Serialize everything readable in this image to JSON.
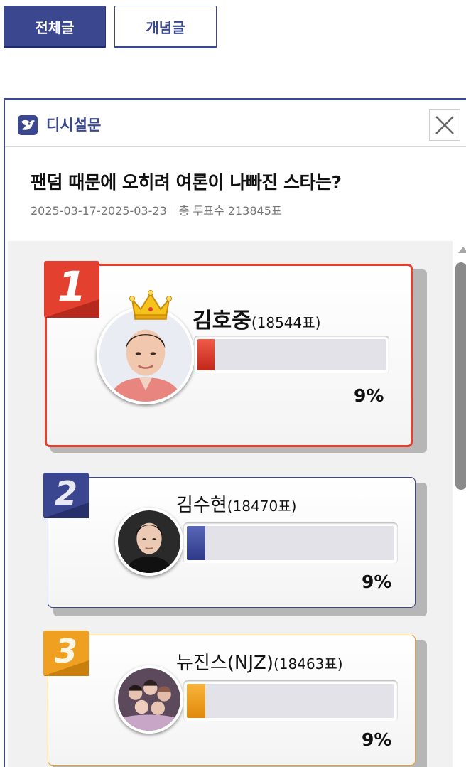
{
  "tabs": {
    "all": "전체글",
    "concept": "개념글"
  },
  "poll": {
    "brand": "디시설문",
    "question": "팬덤 때문에 오히려 여론이 나빠진 스타는?",
    "period": "2025-03-17-2025-03-23",
    "total_label": "총 투표수 213845표",
    "close_label": "close",
    "colors": {
      "accent": "#3b4890",
      "rank1": "#e4402f",
      "rank2": "#3a4690",
      "rank3": "#f0a020"
    },
    "candidates": [
      {
        "rank": "1",
        "name": "김호중",
        "votes": "(18544표)",
        "percent": "9%",
        "fill_fraction": 0.09
      },
      {
        "rank": "2",
        "name": "김수현",
        "votes": "(18470표)",
        "percent": "9%",
        "fill_fraction": 0.09
      },
      {
        "rank": "3",
        "name": "뉴진스(NJZ)",
        "votes": "(18463표)",
        "percent": "9%",
        "fill_fraction": 0.09
      }
    ]
  }
}
